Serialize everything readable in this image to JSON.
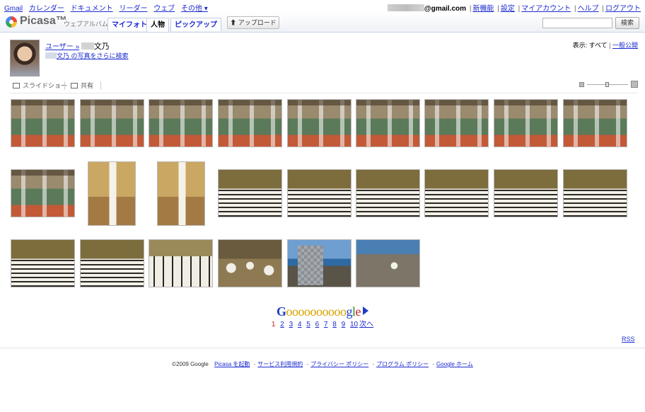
{
  "gbar": {
    "links": [
      "Gmail",
      "カレンダー",
      "ドキュメント",
      "リーダー",
      "ウェブ",
      "その他 ▾"
    ],
    "email_domain": "@gmail.com",
    "right_links": [
      "新機能",
      "設定",
      "マイアカウント",
      "ヘルプ",
      "ログアウト"
    ]
  },
  "header": {
    "logo_word": "Picasa™",
    "logo_sub": "ウェブアルバム",
    "tabs": [
      "マイフォト",
      "人物",
      "ピックアップ"
    ],
    "upload_label": "アップロード",
    "search_value": "",
    "search_label": "検索"
  },
  "user": {
    "crumb_prefix": "ユーザー »",
    "name": "文乃",
    "more_link": "文乃 の写真をさらに検索",
    "view_label": "表示:",
    "view_all": "すべて",
    "view_public": "一般公開"
  },
  "toolbar": {
    "slideshow": "スライドショー",
    "share": "共有"
  },
  "photos": [
    {
      "style": "gym"
    },
    {
      "style": "gym"
    },
    {
      "style": "gym"
    },
    {
      "style": "gym"
    },
    {
      "style": "gym"
    },
    {
      "style": "gym"
    },
    {
      "style": "gym"
    },
    {
      "style": "gym"
    },
    {
      "style": "gym"
    },
    {
      "style": "gym"
    },
    {
      "style": "vert"
    },
    {
      "style": "vert"
    },
    {
      "style": "hallrows"
    },
    {
      "style": "hallrows"
    },
    {
      "style": "hallrows"
    },
    {
      "style": "hallrows"
    },
    {
      "style": "hallrows"
    },
    {
      "style": "hallrows"
    },
    {
      "style": "hallrows"
    },
    {
      "style": "hallrows"
    },
    {
      "style": "ceremony"
    },
    {
      "style": "crowd"
    },
    {
      "style": "sea"
    },
    {
      "style": "rock"
    }
  ],
  "pager": {
    "pages": [
      "1",
      "2",
      "3",
      "4",
      "5",
      "6",
      "7",
      "8",
      "9",
      "10"
    ],
    "next": "次へ"
  },
  "rss": "RSS",
  "footer": {
    "copyright": "©2009 Google",
    "links": [
      "Picasa を起動",
      "サービス利用規約",
      "プライバシー ポリシー",
      "プログラム ポリシー",
      "Google ホーム"
    ]
  }
}
